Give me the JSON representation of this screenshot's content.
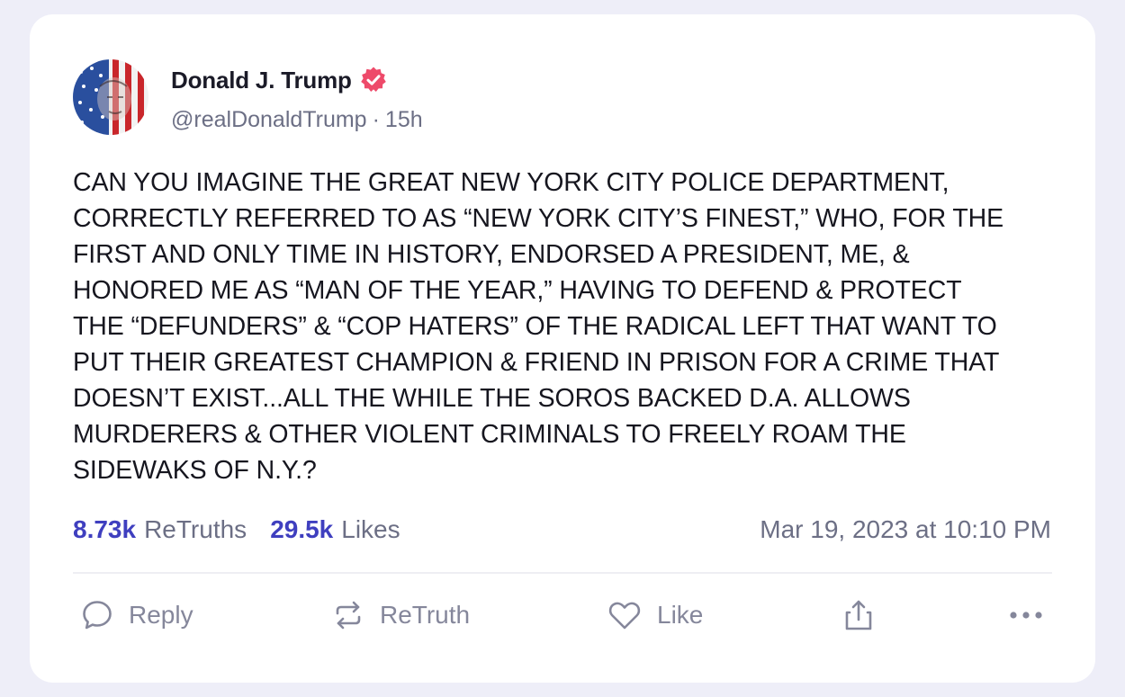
{
  "author": {
    "display_name": "Donald J. Trump",
    "handle": "@realDonaldTrump",
    "time_ago": "15h",
    "verified_icon": "verified-badge-icon"
  },
  "post": {
    "lines": [
      "CAN YOU IMAGINE THE GREAT NEW YORK CITY POLICE DEPARTMENT,",
      "CORRECTLY REFERRED TO AS “NEW YORK CITY’S FINEST,” WHO, FOR THE",
      "FIRST AND ONLY TIME IN HISTORY, ENDORSED A PRESIDENT, ME, &",
      "HONORED ME AS “MAN OF THE YEAR,” HAVING TO DEFEND & PROTECT",
      "THE “DEFUNDERS” & “COP HATERS” OF THE RADICAL LEFT THAT WANT TO",
      "PUT THEIR GREATEST CHAMPION & FRIEND IN PRISON FOR A CRIME THAT",
      "DOESN’T EXIST...ALL THE WHILE THE SOROS BACKED D.A. ALLOWS",
      "MURDERERS & OTHER VIOLENT CRIMINALS TO FREELY ROAM THE",
      "SIDEWAKS OF N.Y.?"
    ]
  },
  "stats": {
    "retruths_count": "8.73k",
    "retruths_label": "ReTruths",
    "likes_count": "29.5k",
    "likes_label": "Likes",
    "timestamp": "Mar 19, 2023 at 10:10 PM"
  },
  "actions": {
    "reply_label": "Reply",
    "retruth_label": "ReTruth",
    "like_label": "Like"
  },
  "icons": {
    "reply": "speech-bubble-icon",
    "retruth": "repost-arrows-icon",
    "like": "heart-icon",
    "share": "share-upload-icon",
    "more": "more-dots-icon"
  },
  "colors": {
    "accent": "#3f3fbf",
    "verified": "#ee4a6a",
    "muted_text": "#6c6f85",
    "background": "#eeeef8"
  }
}
